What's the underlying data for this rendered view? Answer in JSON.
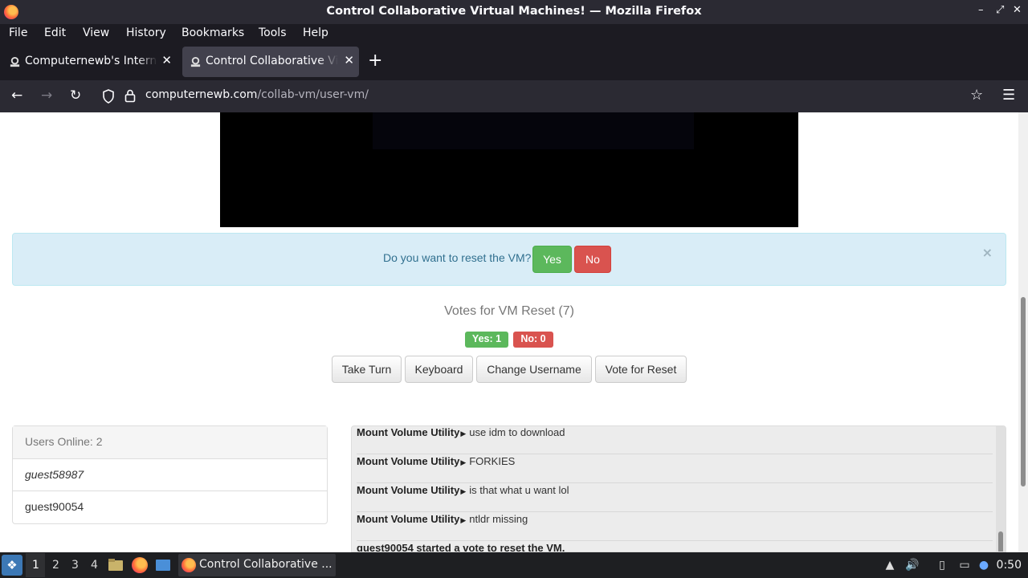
{
  "window": {
    "title": "Control Collaborative Virtual Machines! — Mozilla Firefox",
    "controls": [
      "–",
      "⤢",
      "✕"
    ]
  },
  "menu": [
    "File",
    "Edit",
    "View",
    "History",
    "Bookmarks",
    "Tools",
    "Help"
  ],
  "tabs": [
    {
      "label": "Computernewb's Internet",
      "active": false
    },
    {
      "label": "Control Collaborative Virtual Machines!",
      "active": true
    }
  ],
  "nav": {
    "url_domain": "computernewb.com",
    "url_path": "/collab-vm/user-vm/"
  },
  "reset_prompt": {
    "question": "Do you want to reset the VM?",
    "yes": "Yes",
    "no": "No",
    "close": "×"
  },
  "votes": {
    "title": "Votes for VM Reset (7)",
    "yes_badge": "Yes: 1",
    "no_badge": "No: 0"
  },
  "actions": [
    "Take Turn",
    "Keyboard",
    "Change Username",
    "Vote for Reset"
  ],
  "users": {
    "header": "Users Online: 2",
    "list": [
      "guest58987",
      "guest90054"
    ]
  },
  "chat": [
    {
      "user": "Mount Volume Utility",
      "text": "use idm to download"
    },
    {
      "user": "Mount Volume Utility",
      "text": "FORKIES"
    },
    {
      "user": "Mount Volume Utility",
      "text": "is that what u want lol"
    },
    {
      "user": "Mount Volume Utility",
      "text": "ntldr missing"
    },
    {
      "user": "",
      "text": "guest90054 started a vote to reset the VM."
    }
  ],
  "taskbar": {
    "workspaces": [
      "1",
      "2",
      "3",
      "4"
    ],
    "task_label": "Control Collaborative ...",
    "clock": "0:50"
  }
}
